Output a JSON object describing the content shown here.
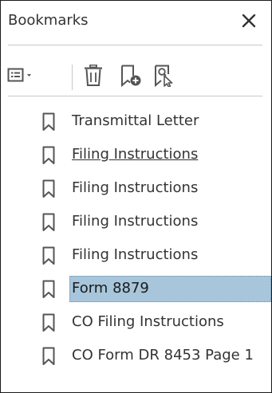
{
  "panel": {
    "title": "Bookmarks",
    "close_icon": "close-icon"
  },
  "toolbar": {
    "buttons": [
      {
        "name": "options-menu-button",
        "icon": "options-list-icon"
      },
      {
        "name": "delete-bookmark-button",
        "icon": "trash-icon"
      },
      {
        "name": "new-bookmark-button",
        "icon": "new-bookmark-icon"
      },
      {
        "name": "find-current-bookmark-button",
        "icon": "find-bookmark-icon"
      }
    ]
  },
  "bookmarks": {
    "items": [
      {
        "label": "Transmittal Letter",
        "state": "normal"
      },
      {
        "label": "Filing Instructions",
        "state": "hover-underline"
      },
      {
        "label": "Filing Instructions",
        "state": "normal"
      },
      {
        "label": "Filing Instructions",
        "state": "normal"
      },
      {
        "label": "Filing Instructions",
        "state": "normal"
      },
      {
        "label": "Form 8879",
        "state": "selected"
      },
      {
        "label": "CO Filing Instructions",
        "state": "normal"
      },
      {
        "label": "CO Form DR 8453 Page 1",
        "state": "normal"
      }
    ],
    "icon": "bookmark-icon"
  },
  "colors": {
    "selection": "#a7c6dc",
    "text": "#333333",
    "icon": "#555555",
    "separator": "#c8c8c8"
  }
}
